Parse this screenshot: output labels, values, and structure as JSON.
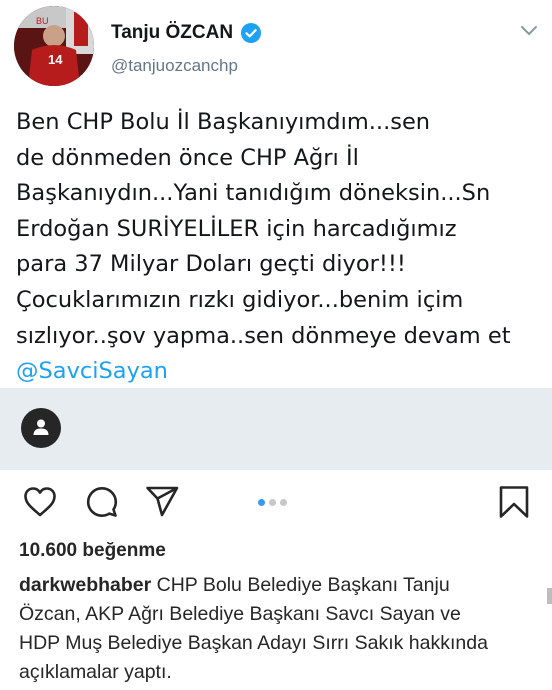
{
  "tweet": {
    "display_name": "Tanju ÖZCAN",
    "handle": "@tanjuozcanchp",
    "verified": true,
    "avatar_icon": "profile-photo",
    "lines": [
      "Ben CHP Bolu İl Başkanıyımdım...sen",
      "de dönmeden önce CHP Ağrı İl",
      "Başkanıydın...Yani tanıdığım döneksin...Sn",
      "Erdoğan SURİYELİLER için harcadığımız",
      "para 37 Milyar Doları geçti diyor!!!",
      "Çocuklarımızın rızkı gidiyor...benim içim",
      "sızlıyor..şov yapma..sen dönmeye devam et"
    ],
    "mention": "@SavciSayan",
    "avatar_number": "14"
  },
  "post": {
    "likes": "10.600 beğenme",
    "carousel": {
      "count": 3,
      "active_index": 0
    },
    "caption": {
      "username": "darkwebhaber",
      "lines": [
        " CHP Bolu Belediye Başkanı Tanju",
        "Özcan, AKP Ağrı Belediye Başkanı Savcı Sayan ve",
        "HDP Muş Belediye Başkan Adayı Sırrı Sakık hakkında",
        "açıklamalar yaptı."
      ]
    }
  },
  "icons": {
    "like": "heart-icon",
    "comment": "comment-icon",
    "share": "share-icon",
    "save": "bookmark-icon",
    "caret": "chevron-down-icon",
    "tag": "user-tag-icon"
  },
  "colors": {
    "verified": "#1da1f2",
    "mention": "#1da1f2",
    "carousel_active": "#3897f0",
    "media_strip": "#e6ecf0"
  }
}
